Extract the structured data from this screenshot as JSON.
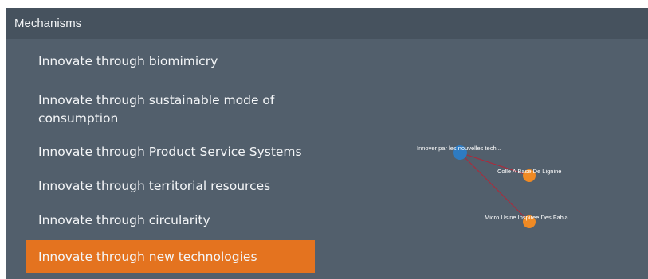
{
  "header": {
    "title": "Mechanisms"
  },
  "menu": {
    "items": [
      {
        "label": "Innovate through biomimicry"
      },
      {
        "label": "Innovate through sustainable mode of consumption"
      },
      {
        "label": "Innovate through Product Service Systems"
      },
      {
        "label": "Innovate through territorial resources"
      },
      {
        "label": "Innovate through circularity"
      },
      {
        "label": "Innovate through new technologies"
      }
    ],
    "selected": "Innovate through new technologies"
  },
  "graph": {
    "nodes": [
      {
        "label": "Innover par les nouvelles tech...",
        "type": "mechanism"
      },
      {
        "label": "Colle A Base De Lignine",
        "type": "case"
      },
      {
        "label": "Micro Usine Inspiree Des Fabla...",
        "type": "case"
      }
    ],
    "colors": {
      "mechanism": "#2e7bc2",
      "case": "#f08a24",
      "edge": "#b0283a"
    }
  },
  "colors": {
    "panel": "#525f6c",
    "header": "#46525e",
    "active": "#e4731f"
  }
}
